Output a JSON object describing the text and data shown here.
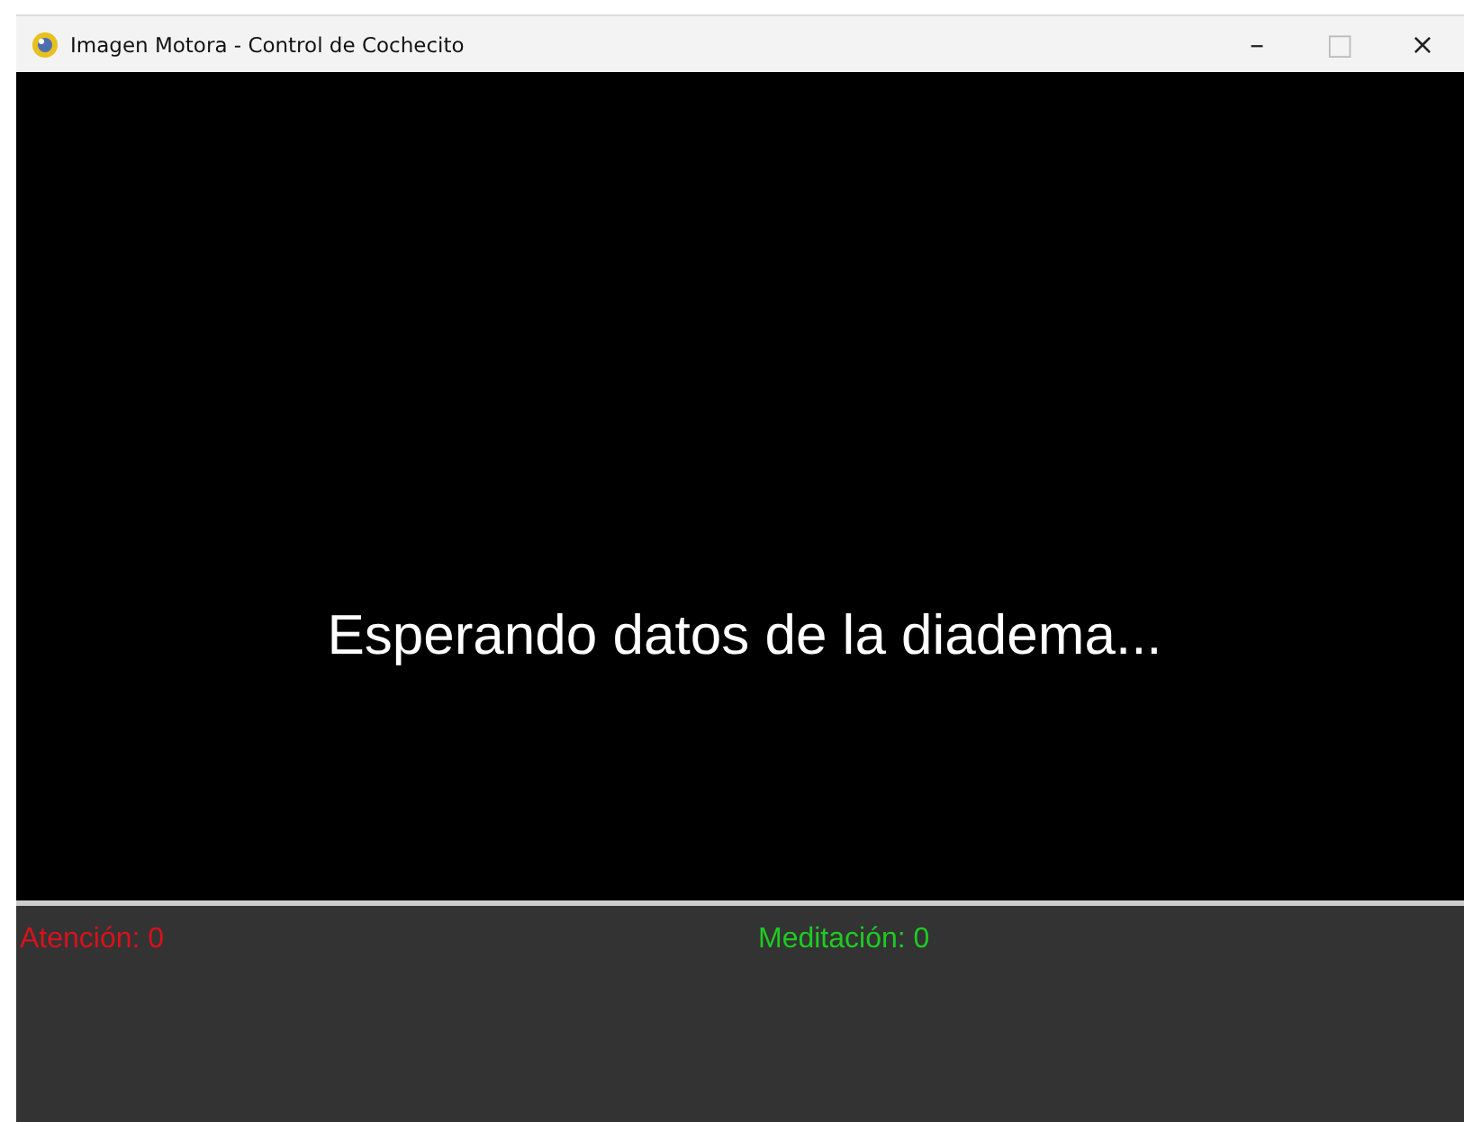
{
  "window": {
    "title": "Imagen Motora - Control de Cochecito"
  },
  "title_buttons": [
    "–",
    "□",
    "×"
  ],
  "display": {
    "message": "Esperando datos de la diadema..."
  },
  "stats": [
    {
      "label": "Atención: 0",
      "color": "#d8121c"
    },
    {
      "label": "Meditación: 0",
      "color": "#1ecb22"
    }
  ]
}
